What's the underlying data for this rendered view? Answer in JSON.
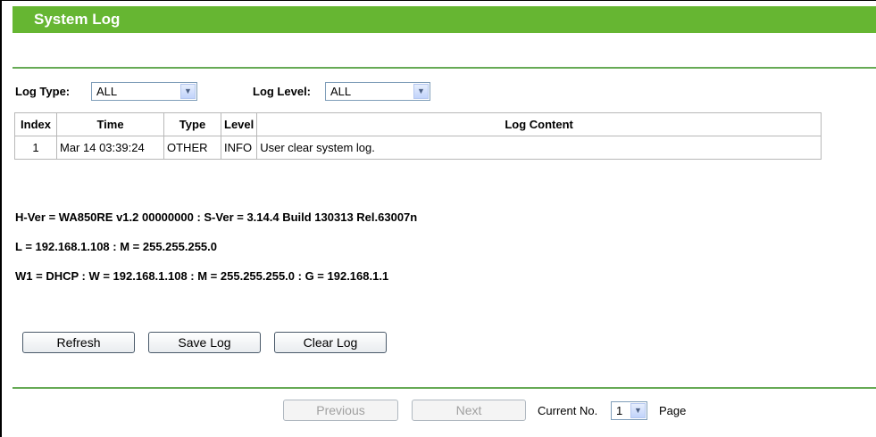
{
  "page": {
    "title": "System Log"
  },
  "filters": {
    "log_type_label": "Log Type:",
    "log_type_value": "ALL",
    "log_level_label": "Log Level:",
    "log_level_value": "ALL"
  },
  "table": {
    "headers": [
      "Index",
      "Time",
      "Type",
      "Level",
      "Log Content"
    ],
    "rows": [
      [
        "1",
        "Mar 14 03:39:24",
        "OTHER",
        "INFO",
        "User clear system log."
      ]
    ]
  },
  "system_info": {
    "version_line": "H-Ver = WA850RE v1.2 00000000 : S-Ver = 3.14.4 Build 130313 Rel.63007n",
    "lan_line": "L = 192.168.1.108 : M = 255.255.255.0",
    "wan_line": "W1 = DHCP : W = 192.168.1.108 : M = 255.255.255.0 : G = 192.168.1.1"
  },
  "actions": {
    "refresh_label": "Refresh",
    "save_label": "Save Log",
    "clear_label": "Clear Log"
  },
  "pager": {
    "previous_label": "Previous",
    "next_label": "Next",
    "current_label": "Current No.",
    "current_value": "1",
    "page_label": "Page"
  },
  "colors": {
    "title_bar": "#66b632",
    "divider": "#66aa55"
  }
}
